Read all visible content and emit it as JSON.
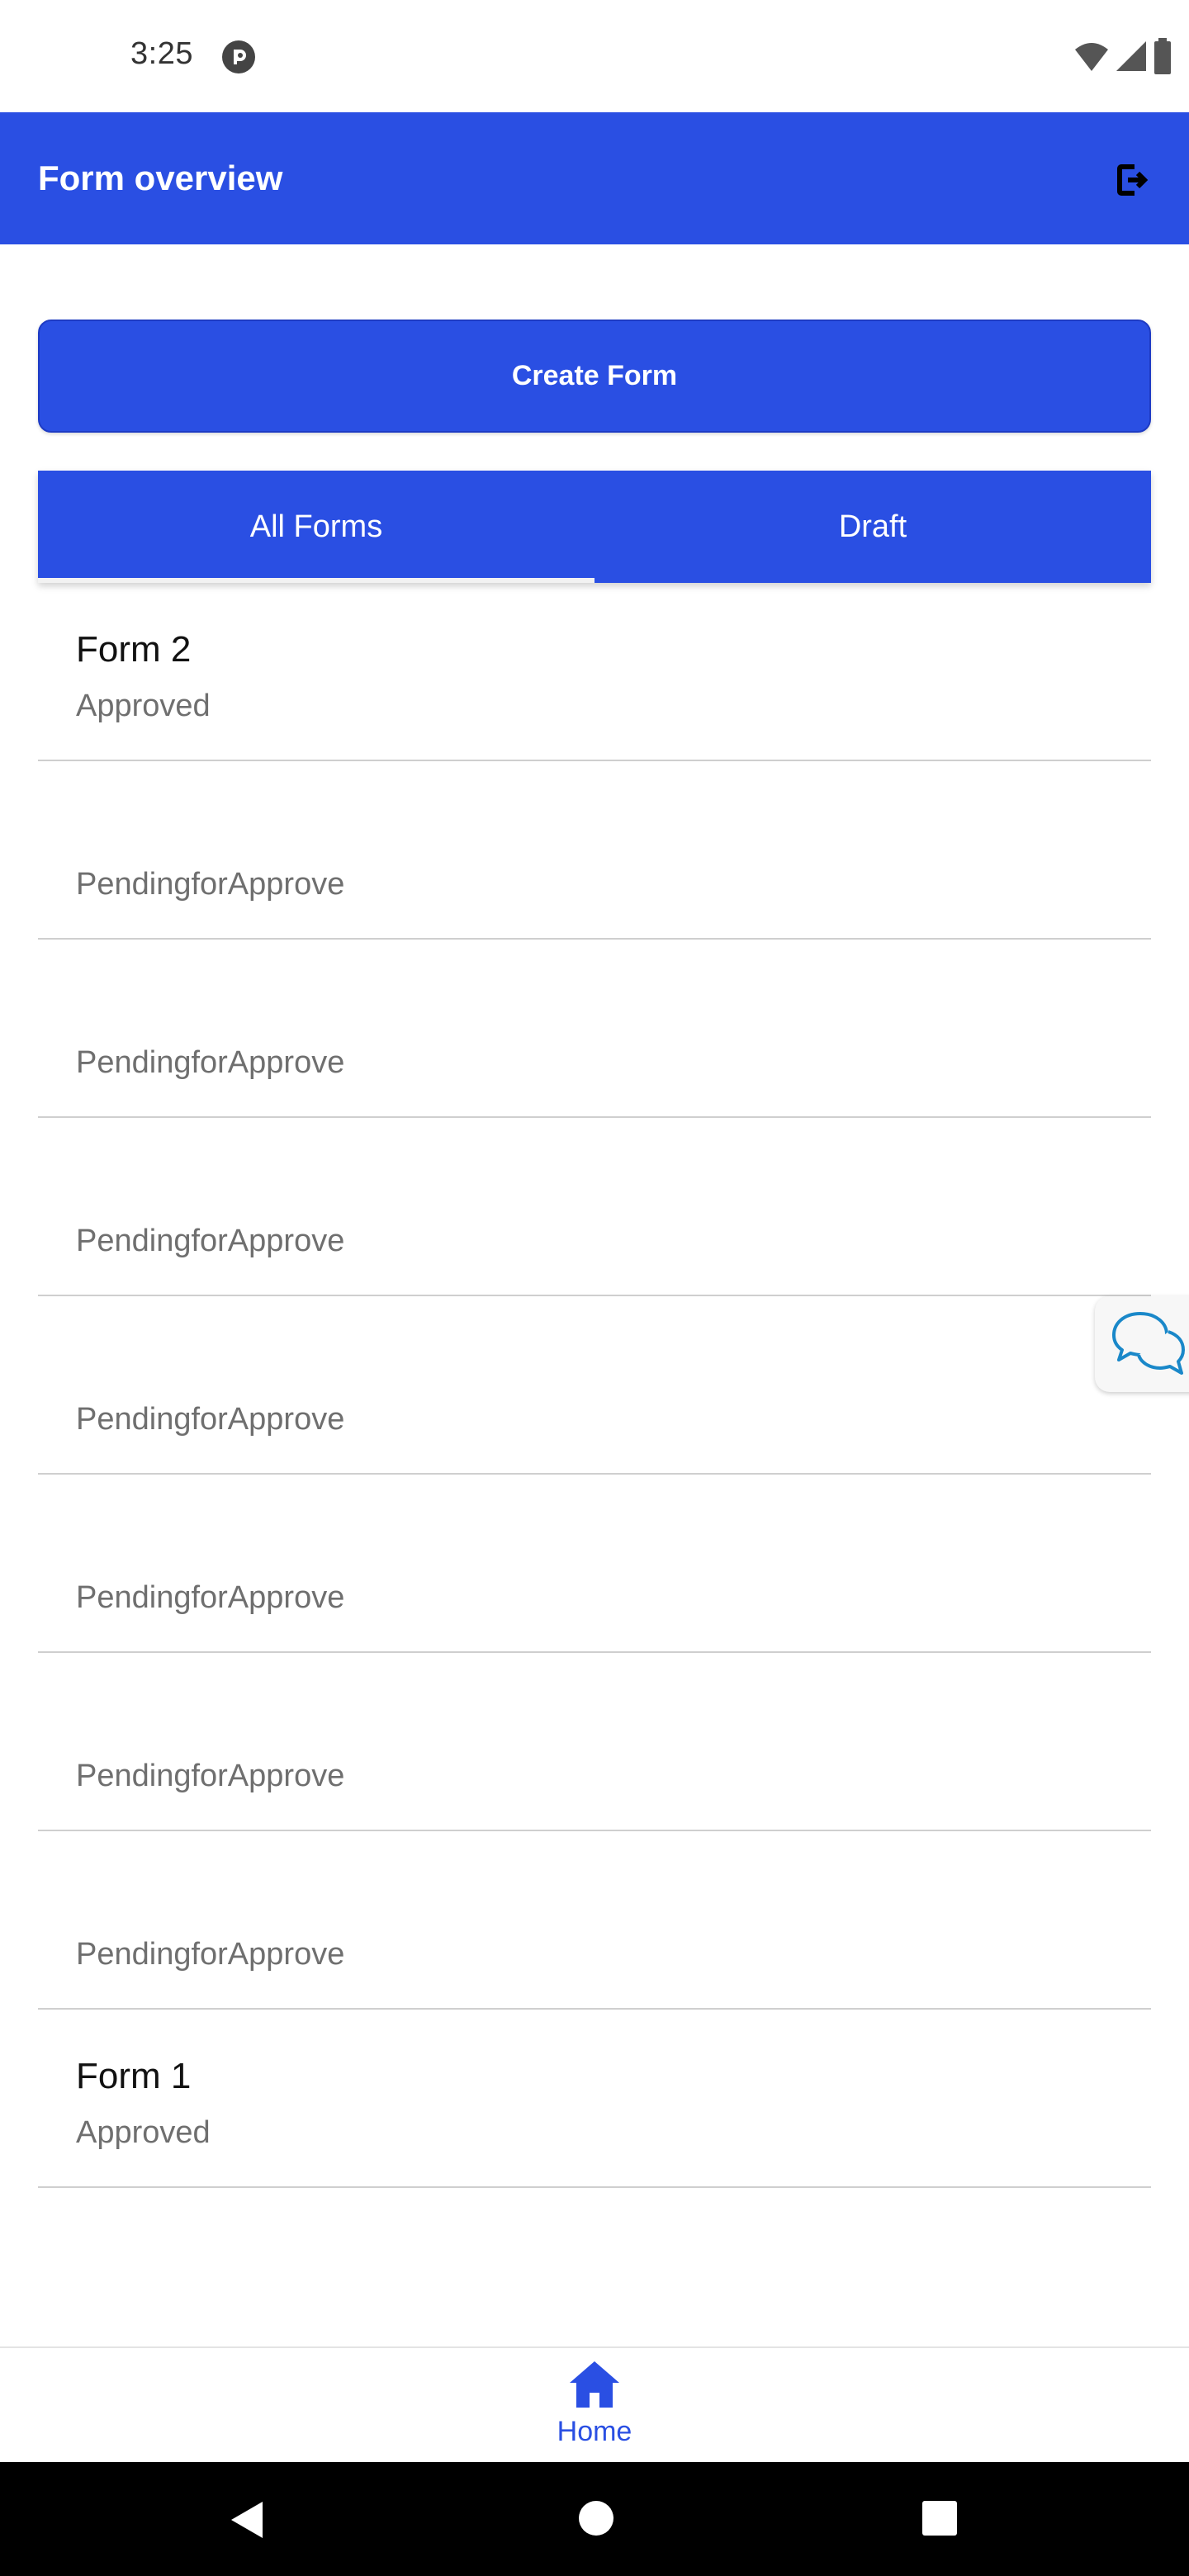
{
  "status_bar": {
    "time": "3:25",
    "app_icon": "pocket-casts-icon",
    "right_icons": [
      "wifi-icon",
      "signal-icon",
      "battery-icon"
    ]
  },
  "app_bar": {
    "title": "Form overview",
    "action_icon": "logout-icon"
  },
  "create_button": {
    "label": "Create Form"
  },
  "tabs": [
    {
      "label": "All Forms",
      "active": true
    },
    {
      "label": "Draft",
      "active": false
    }
  ],
  "forms": [
    {
      "title": "Form 2",
      "status": "Approved"
    },
    {
      "title": "",
      "status": "PendingforApprove"
    },
    {
      "title": "",
      "status": "PendingforApprove"
    },
    {
      "title": "",
      "status": "PendingforApprove"
    },
    {
      "title": "",
      "status": "PendingforApprove"
    },
    {
      "title": "",
      "status": "PendingforApprove"
    },
    {
      "title": "",
      "status": "PendingforApprove"
    },
    {
      "title": "",
      "status": "PendingforApprove"
    },
    {
      "title": "Form 1",
      "status": "Approved"
    }
  ],
  "chat_button": {
    "icon": "chat-bubbles-icon"
  },
  "bottom_nav": {
    "items": [
      {
        "label": "Home",
        "icon": "home-icon",
        "active": true
      }
    ]
  },
  "system_nav": {
    "icons": [
      "back-icon",
      "home-circle-icon",
      "recents-icon"
    ]
  },
  "colors": {
    "primary": "#2a4fe3",
    "divider": "#cfcfcf",
    "status_text": "#6f6f6f",
    "chat_icon": "#1a88c9"
  }
}
